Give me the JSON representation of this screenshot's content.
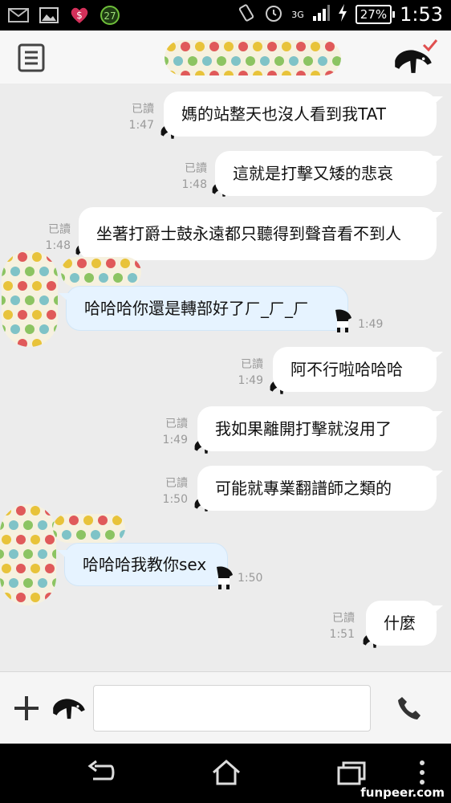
{
  "status_bar": {
    "time": "1:53",
    "battery": "27%",
    "network": "3G",
    "notification_badge": "27",
    "icons": [
      "mail-icon",
      "image-icon",
      "heart-dollar-icon",
      "badge-icon",
      "vibrate-icon",
      "alarm-icon",
      "signal-icon",
      "charging-icon",
      "battery-icon"
    ]
  },
  "header": {
    "menu_icon": "menu-icon",
    "title_icon": "polka-dot-blob",
    "right_icon": "tapir-check-icon"
  },
  "messages": [
    {
      "side": "sent",
      "text": "媽的站整天也沒人看到我TAT",
      "read": "已讀",
      "time": "1:47"
    },
    {
      "side": "sent",
      "text": "這就是打擊又矮的悲哀",
      "read": "已讀",
      "time": "1:48"
    },
    {
      "side": "sent",
      "text": "坐著打爵士鼓永遠都只聽得到聲音看不到人",
      "read": "已讀",
      "time": "1:48"
    },
    {
      "side": "received",
      "text": "哈哈哈你還是轉部好了ㄏ_ㄏ_ㄏ",
      "time": "1:49"
    },
    {
      "side": "sent",
      "text": "阿不行啦哈哈哈",
      "read": "已讀",
      "time": "1:49"
    },
    {
      "side": "sent",
      "text": "我如果離開打擊就沒用了",
      "read": "已讀",
      "time": "1:49"
    },
    {
      "side": "sent",
      "text": "可能就專業翻譜師之類的",
      "read": "已讀",
      "time": "1:50"
    },
    {
      "side": "received",
      "text": "哈哈哈我教你sex",
      "time": "1:50"
    },
    {
      "side": "sent",
      "text": "什麼",
      "read": "已讀",
      "time": "1:51"
    }
  ],
  "input_bar": {
    "placeholder": "",
    "value": "",
    "icons": [
      "plus-icon",
      "sticker-icon",
      "phone-icon"
    ]
  },
  "nav_bar": {
    "icons": [
      "back-icon",
      "home-icon",
      "recent-apps-icon",
      "overflow-menu-icon"
    ]
  },
  "watermark": "funpeer.com",
  "colors": {
    "chat_background": "#ececec",
    "sent_bubble": "#ffffff",
    "received_bubble": "#e6f3ff",
    "meta_text": "#9a9a9a"
  }
}
